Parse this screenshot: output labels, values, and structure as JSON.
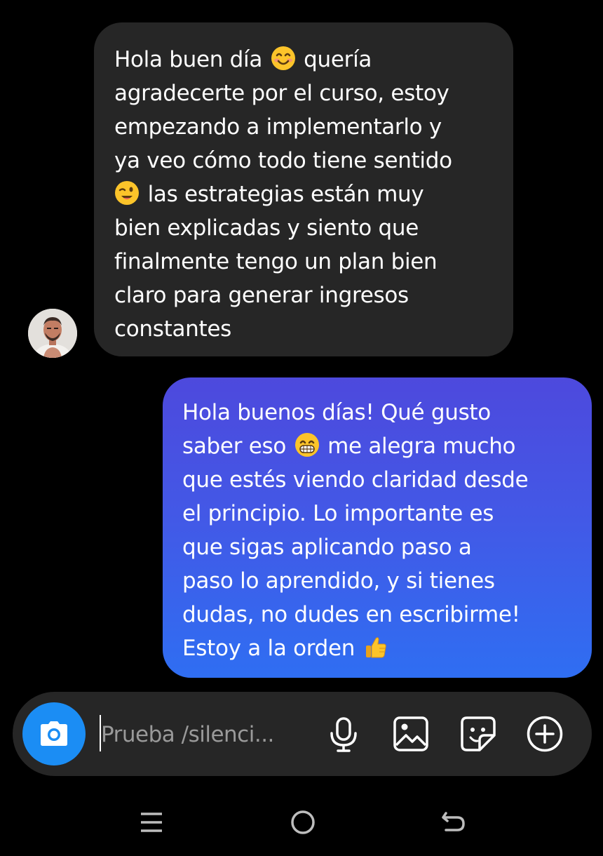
{
  "conversation": {
    "incoming": {
      "lines": [
        [
          "Hola buen día",
          "smiling-face-emoji",
          "quería"
        ],
        [
          "agradecerte por el curso, estoy"
        ],
        [
          "empezando a implementarlo y"
        ],
        [
          "ya veo cómo todo tiene sentido"
        ],
        [
          "",
          "winking-face-emoji",
          "las estrategias están muy"
        ],
        [
          "bien explicadas y siento que"
        ],
        [
          "finalmente tengo un plan bien"
        ],
        [
          "claro para generar ingresos"
        ],
        [
          "constantes"
        ]
      ]
    },
    "outgoing": {
      "lines": [
        [
          "Hola buenos días! Qué gusto"
        ],
        [
          "saber eso",
          "grinning-face-emoji",
          "me alegra mucho"
        ],
        [
          "que estés viendo claridad desde"
        ],
        [
          "el principio. Lo importante es"
        ],
        [
          "que sigas aplicando paso a"
        ],
        [
          "paso lo aprendido, y si tienes"
        ],
        [
          "dudas, no dudes en escribirme!"
        ],
        [
          "Estoy a la orden",
          "thumbs-up-emoji",
          ""
        ]
      ]
    }
  },
  "composer": {
    "placeholder": "Prueba /silenci...",
    "icons": [
      "camera-icon",
      "microphone-icon",
      "gallery-icon",
      "sticker-icon",
      "plus-icon"
    ]
  },
  "navigation": {
    "icons": [
      "recents-icon",
      "home-icon",
      "back-icon"
    ]
  },
  "colors": {
    "background": "#000000",
    "incoming_bubble": "#262626",
    "outgoing_gradient_top": "#4d49dd",
    "outgoing_gradient_bottom": "#2f6ef2",
    "camera_button": "#1b8df4",
    "placeholder_text": "#9a9a9a"
  }
}
